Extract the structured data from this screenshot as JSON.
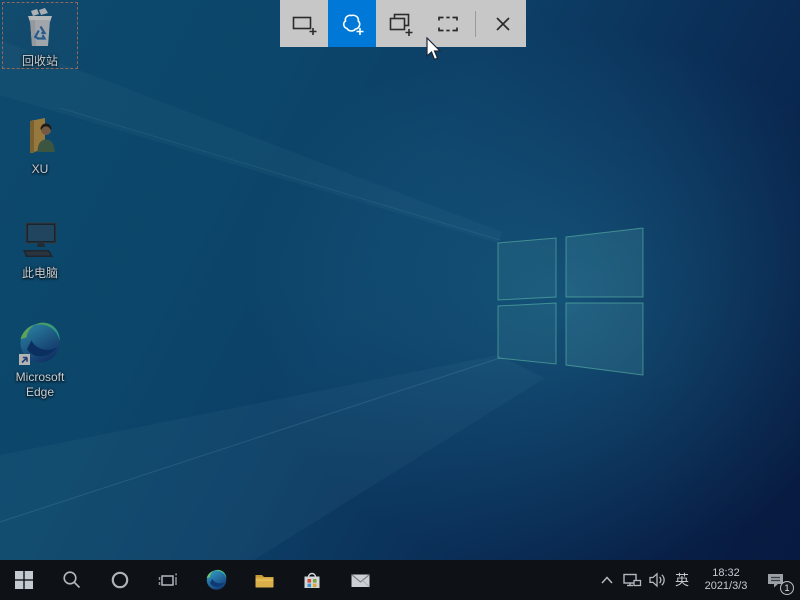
{
  "snip_toolbar": {
    "tools": [
      {
        "id": "rectangular-snip",
        "selected": false
      },
      {
        "id": "freeform-snip",
        "selected": true
      },
      {
        "id": "window-snip",
        "selected": false
      },
      {
        "id": "fullscreen-snip",
        "selected": false
      }
    ],
    "close_icon": "close-icon",
    "selected_color": "#0078d7",
    "background_color": "#c7c7c7"
  },
  "desktop": {
    "icons": [
      {
        "name": "recycle-bin",
        "label": "回收站",
        "selected": true
      },
      {
        "name": "user-folder",
        "label": "XU",
        "selected": false
      },
      {
        "name": "this-pc",
        "label": "此电脑",
        "selected": false
      },
      {
        "name": "microsoft-edge",
        "label": "Microsoft Edge",
        "selected": false
      }
    ]
  },
  "taskbar": {
    "buttons": [
      "start",
      "search",
      "cortana",
      "task-view",
      "edge",
      "file-explorer",
      "store",
      "mail"
    ],
    "tray": {
      "hidden_icons": "chevron-up",
      "network": "network-icon",
      "volume": "volume-icon",
      "ime": "英",
      "time": "18:32",
      "date": "2021/3/3",
      "notification_count": "1"
    },
    "background_color": "#0e1217"
  }
}
